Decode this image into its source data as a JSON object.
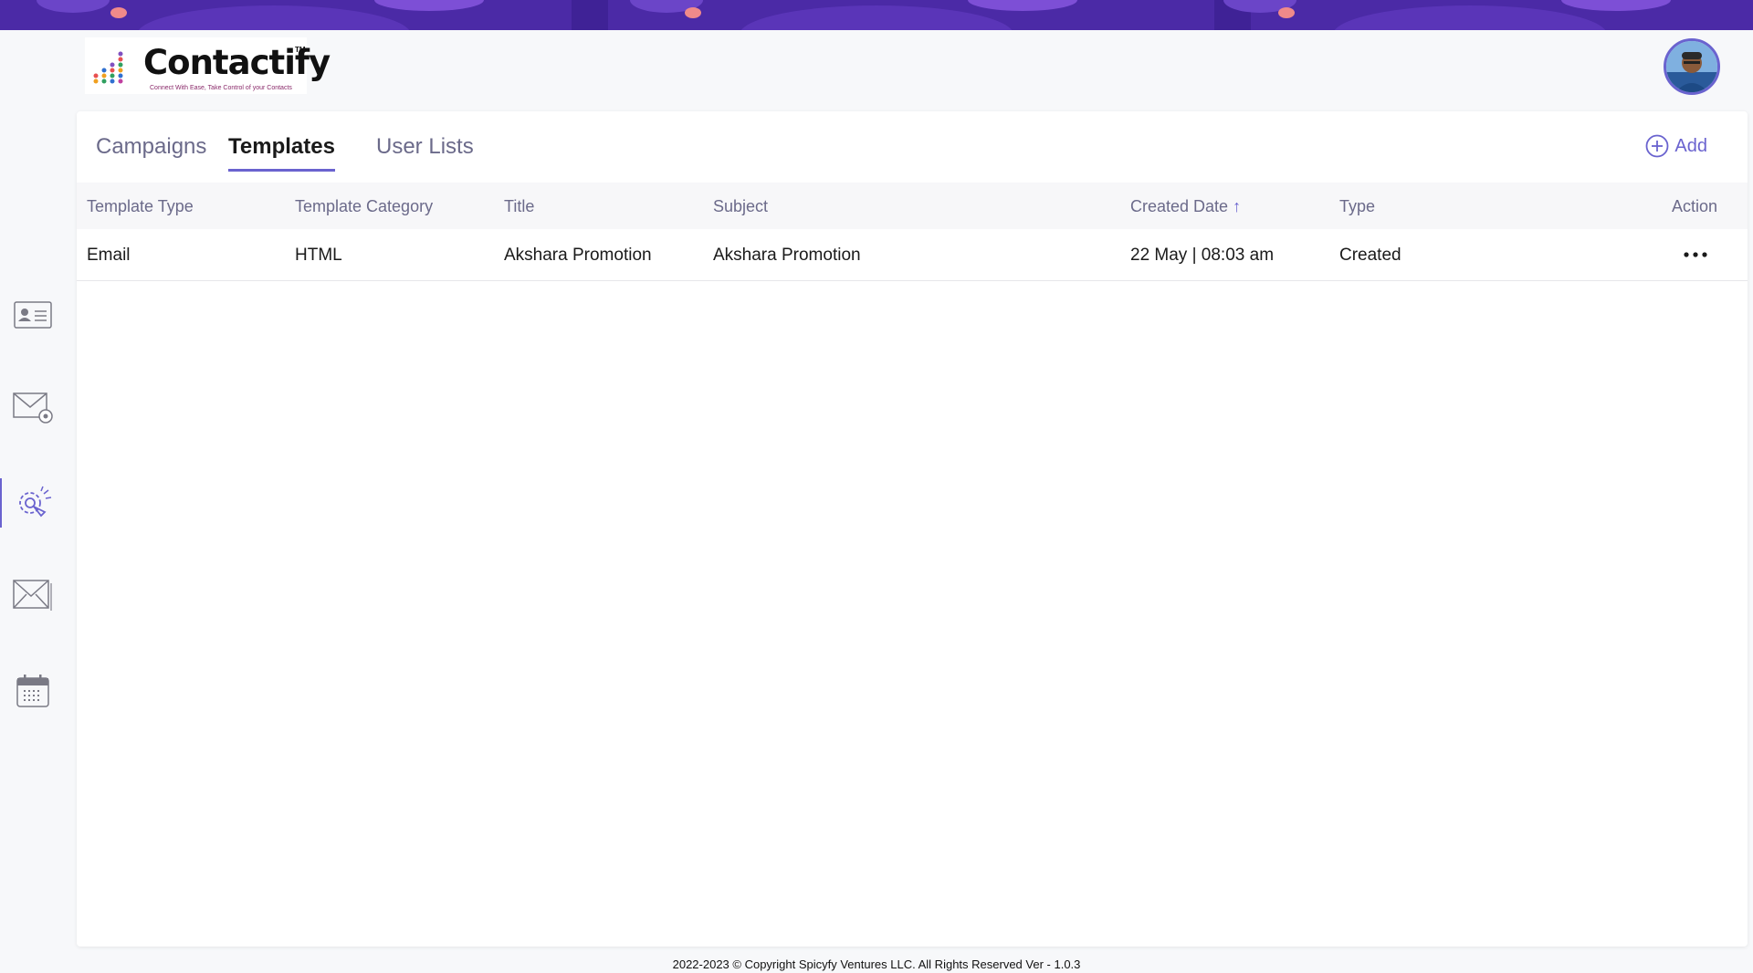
{
  "brand": {
    "name": "Contactify",
    "trademark": "TM",
    "tagline": "Connect With Ease, Take Control of your Contacts"
  },
  "header": {
    "avatar_icon": "user-avatar"
  },
  "sidebar": {
    "items": [
      {
        "icon": "contact-card-icon"
      },
      {
        "icon": "mail-settings-icon"
      },
      {
        "icon": "campaign-gear-icon",
        "active": true
      },
      {
        "icon": "envelope-icon"
      },
      {
        "icon": "calendar-icon"
      }
    ]
  },
  "tabs": [
    {
      "label": "Campaigns"
    },
    {
      "label": "Templates",
      "active": true
    },
    {
      "label": "User Lists"
    }
  ],
  "toolbar": {
    "add_label": "Add"
  },
  "table": {
    "headers": [
      "Template Type",
      "Template Category",
      "Title",
      "Subject",
      "Created Date",
      "Type",
      "Action"
    ],
    "sort_indicator": "↑",
    "rows": [
      {
        "template_type": "Email",
        "template_category": "HTML",
        "title": "Akshara Promotion",
        "subject": "Akshara Promotion",
        "created_date": "22 May | 08:03 am",
        "type": "Created"
      }
    ]
  },
  "footer": {
    "copyright": "2022-2023 © Copyright Spicyfy Ventures LLC. All Rights Reserved",
    "version": "Ver - 1.0.3"
  },
  "colors": {
    "accent": "#6a63cf",
    "banner": "#4b2aa6"
  }
}
